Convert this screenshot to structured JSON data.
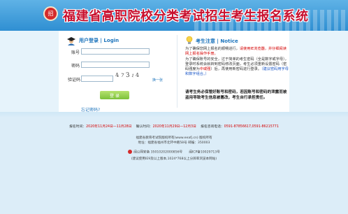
{
  "header": {
    "logo_text": "招",
    "title": "福建省高职院校分类考试招生考生报名系统"
  },
  "login": {
    "title": "用户登录 | Login",
    "account_label": "账号",
    "password_label": "密码",
    "captcha_label": "验证码",
    "captcha_chars": [
      "4",
      "7",
      "3",
      "1",
      "4"
    ],
    "refresh_label": "换一张",
    "login_button": "登 录",
    "forgot_link": "忘记密码?"
  },
  "notice": {
    "title": "考生注意 | Notice",
    "p1_pre": "为了确保您网上报名的顺畅进行，",
    "p1_red": "请使用IE浏览器，并仔细阅读网上报名操作手册。",
    "p2_pre": "为了确保账号的安全，过于简单的考生密码（全是数字或字母），登录时系统会就转到密码修改页面，考生必须重新设置密码（密码强度为",
    "p2_strong": "中或强",
    "p2_post": "）后，再使用新密码进行登录。",
    "p2_blue": "（建议密码用字母和数字组合。）",
    "bold": "请考生务必保管好账号和密码，若因账号和密码的泄露而被盗用导致考生信息被篡改，考生自行承担责任。"
  },
  "footer": {
    "date1_label": "报名时间：",
    "date1_value": "2020年11月24日—11月28日",
    "date2_label": "确认时间：",
    "date2_value": "2020年11月29日—12月3日",
    "phone_label": "报名咨询电话：",
    "phone_value": "0591-87856617,0591-86215771",
    "line1": "福建省教育考试院版权所有(www.eeafj.cn) 版权所有",
    "line2": "地址：福建省福州市北环中路58号 邮编：350003",
    "line3": "闽公网安备 35010202000856号　　闽ICP备10029713号",
    "line4": "(建议使用IE9及以上版本,1024*768以上分辨率浏览本网站)"
  },
  "colors": {
    "brand_blue": "#2f8fd2",
    "title_red": "#c8102e",
    "button_green": "#7cc13a"
  },
  "icons": {
    "login": "user-graduate-icon",
    "notice": "lightbulb-icon",
    "police": "police-badge-icon"
  }
}
